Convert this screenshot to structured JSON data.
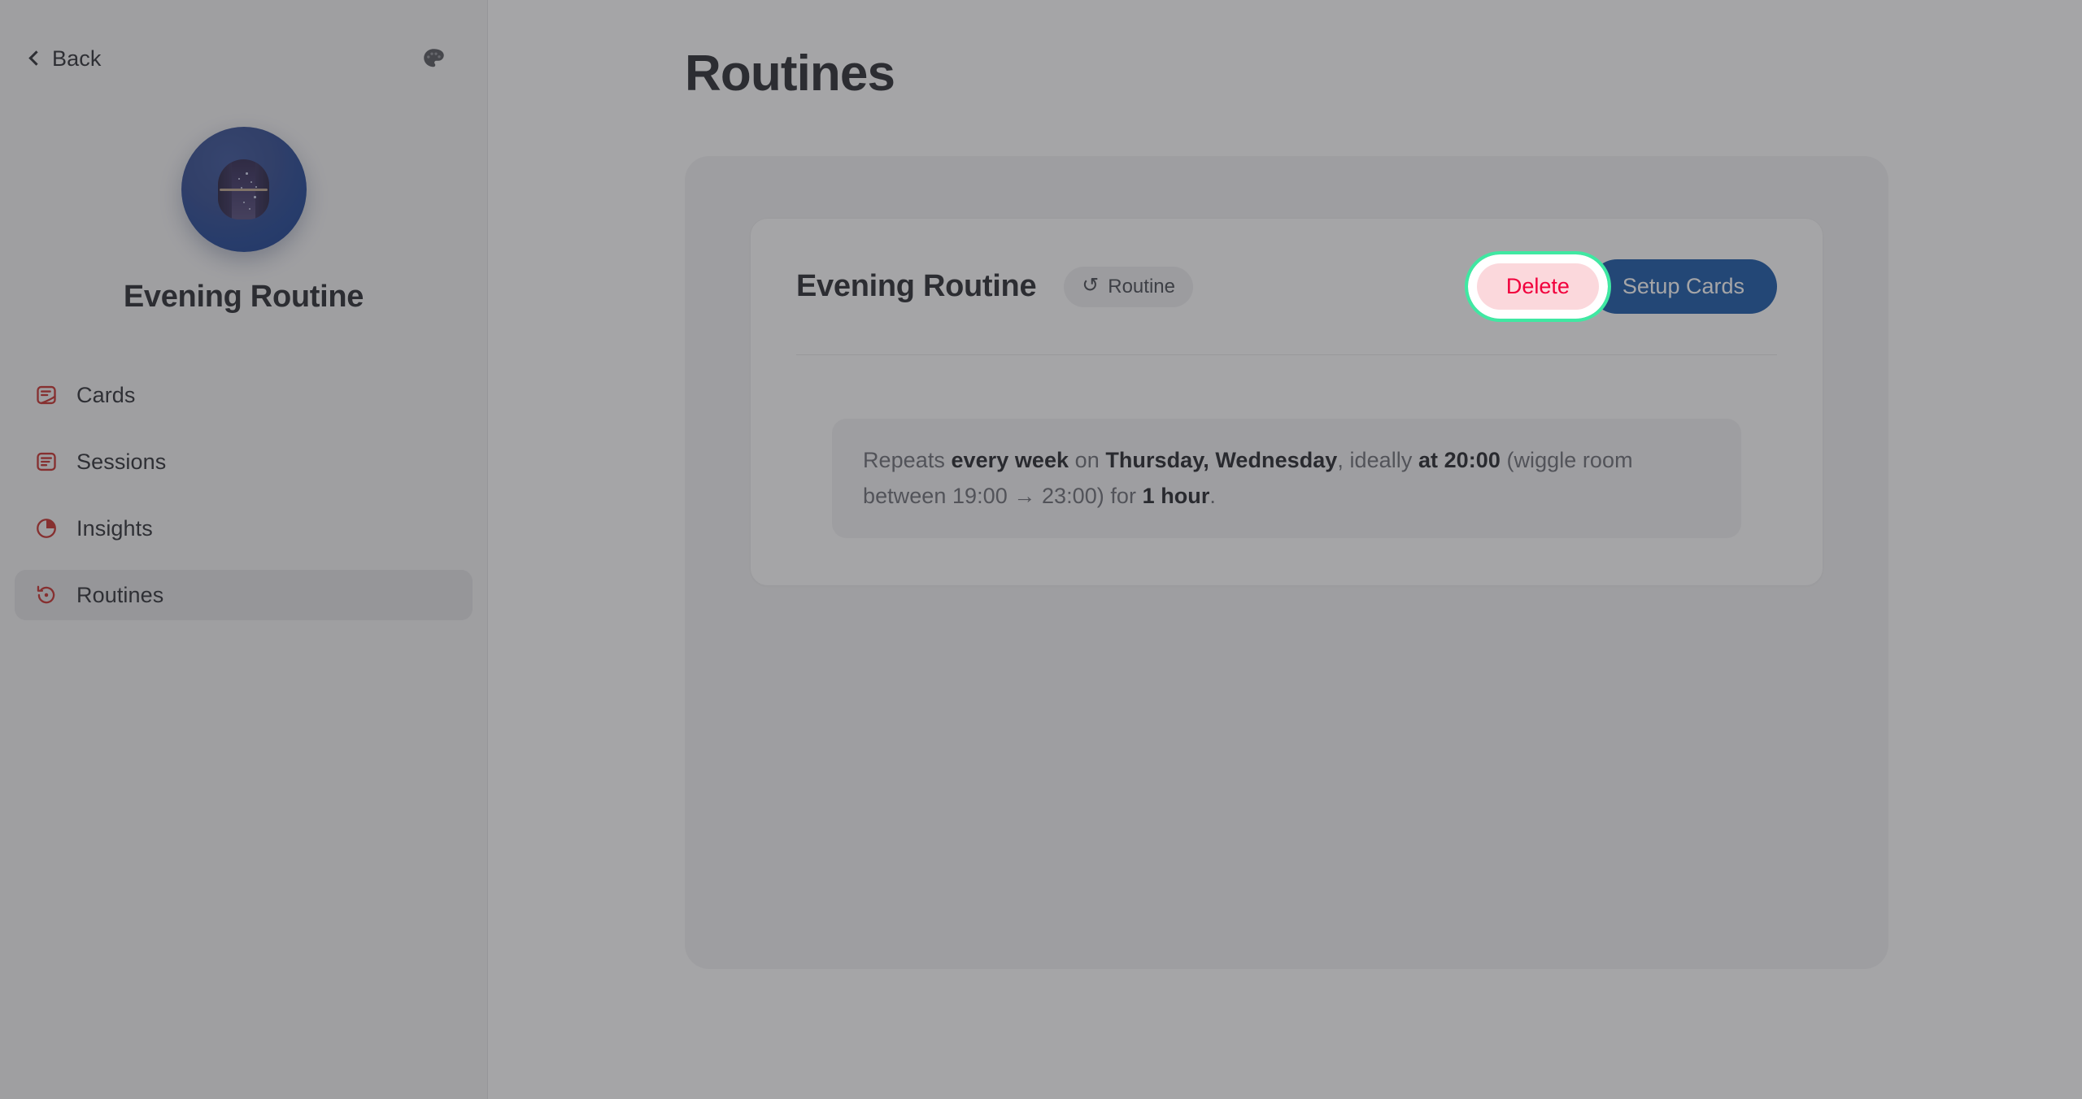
{
  "sidebar": {
    "back_label": "Back",
    "back_icon": "chevron-left-icon",
    "theme_icon": "palette-icon",
    "avatar_icon": "night-window-avatar",
    "profile_name": "Evening Routine",
    "items": [
      {
        "label": "Cards",
        "icon": "card-icon"
      },
      {
        "label": "Sessions",
        "icon": "list-lines-icon"
      },
      {
        "label": "Insights",
        "icon": "pie-chart-icon"
      },
      {
        "label": "Routines",
        "icon": "history-rotate-icon"
      }
    ],
    "active_index": 3
  },
  "main": {
    "page_title": "Routines",
    "routine": {
      "title": "Evening Routine",
      "badge_label": "Routine",
      "badge_icon": "rotate-ccw-icon",
      "delete_label": "Delete",
      "setup_label": "Setup Cards",
      "schedule": {
        "prefix": "Repeats ",
        "frequency": "every week",
        "mid1": " on ",
        "days": "Thursday, Wednesday",
        "mid2": ", ideally ",
        "time": "at 20:00",
        "mid3": " (wiggle room between 19:00 ",
        "arrow": "→",
        "mid4": " 23:00) for ",
        "duration": "1 hour",
        "suffix": "."
      }
    }
  },
  "colors": {
    "accent_red": "#c5221f",
    "delete_text": "#f1003c",
    "delete_bg": "#fbd8dc",
    "setup_bg": "#0b4ea2",
    "focus_ring": "#3fe8a2",
    "avatar_blue": "#123a8e",
    "scrim": "rgba(64,64,68,0.47)"
  }
}
